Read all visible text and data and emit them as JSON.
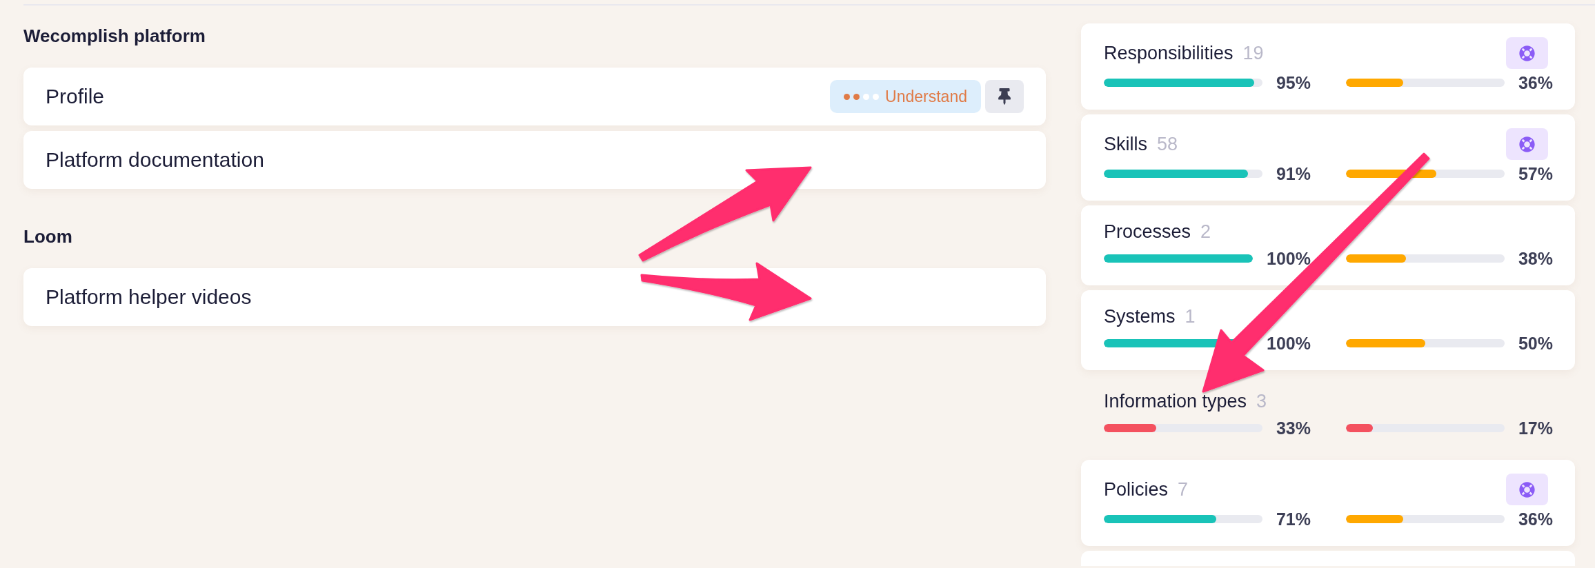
{
  "sections": [
    {
      "heading": "Wecomplish platform",
      "items": [
        {
          "label": "Profile",
          "badge": {
            "label": "Understand",
            "level": 0.5
          },
          "pin_button": true
        },
        {
          "label": "Platform documentation",
          "pin_button": false
        }
      ]
    },
    {
      "heading": "Loom",
      "items": [
        {
          "label": "Platform helper videos",
          "pin_button": false
        }
      ]
    }
  ],
  "metrics": [
    {
      "kind": "card",
      "title": "Responsibilities",
      "count": "19",
      "help_button": true,
      "bars": [
        {
          "level": 0.95,
          "color": "#19c3b8",
          "reading": "95%"
        },
        {
          "level": 0.36,
          "color": "#ffa800",
          "reading": "36%"
        }
      ]
    },
    {
      "kind": "card",
      "title": "Skills",
      "count": "58",
      "help_button": true,
      "bars": [
        {
          "level": 0.91,
          "color": "#19c3b8",
          "reading": "91%"
        },
        {
          "level": 0.57,
          "color": "#ffa800",
          "reading": "57%"
        }
      ]
    },
    {
      "kind": "card",
      "title": "Processes",
      "count": "2",
      "help_button": false,
      "bars": [
        {
          "level": 1,
          "color": "#19c3b8",
          "reading": "100%"
        },
        {
          "level": 0.38,
          "color": "#ffa800",
          "reading": "38%"
        }
      ]
    },
    {
      "kind": "card",
      "title": "Systems",
      "count": "1",
      "help_button": false,
      "bars": [
        {
          "level": 1,
          "color": "#19c3b8",
          "reading": "100%"
        },
        {
          "level": 0.5,
          "color": "#ffa800",
          "reading": "50%"
        }
      ]
    },
    {
      "kind": "plain",
      "title": "Information types",
      "count": "3",
      "help_button": false,
      "bars": [
        {
          "level": 0.33,
          "color": "#f4515f",
          "reading": "33%"
        },
        {
          "level": 0.17,
          "color": "#f4515f",
          "reading": "17%"
        }
      ]
    },
    {
      "kind": "card",
      "title": "Policies",
      "count": "7",
      "help_button": true,
      "bars": [
        {
          "level": 0.71,
          "color": "#19c3b8",
          "reading": "71%"
        },
        {
          "level": 0.36,
          "color": "#ffa800",
          "reading": "36%"
        }
      ]
    },
    {
      "kind": "partial"
    }
  ],
  "annotations": [
    {
      "kind": "arrow"
    },
    {
      "kind": "arrow"
    },
    {
      "kind": "arrow"
    }
  ]
}
